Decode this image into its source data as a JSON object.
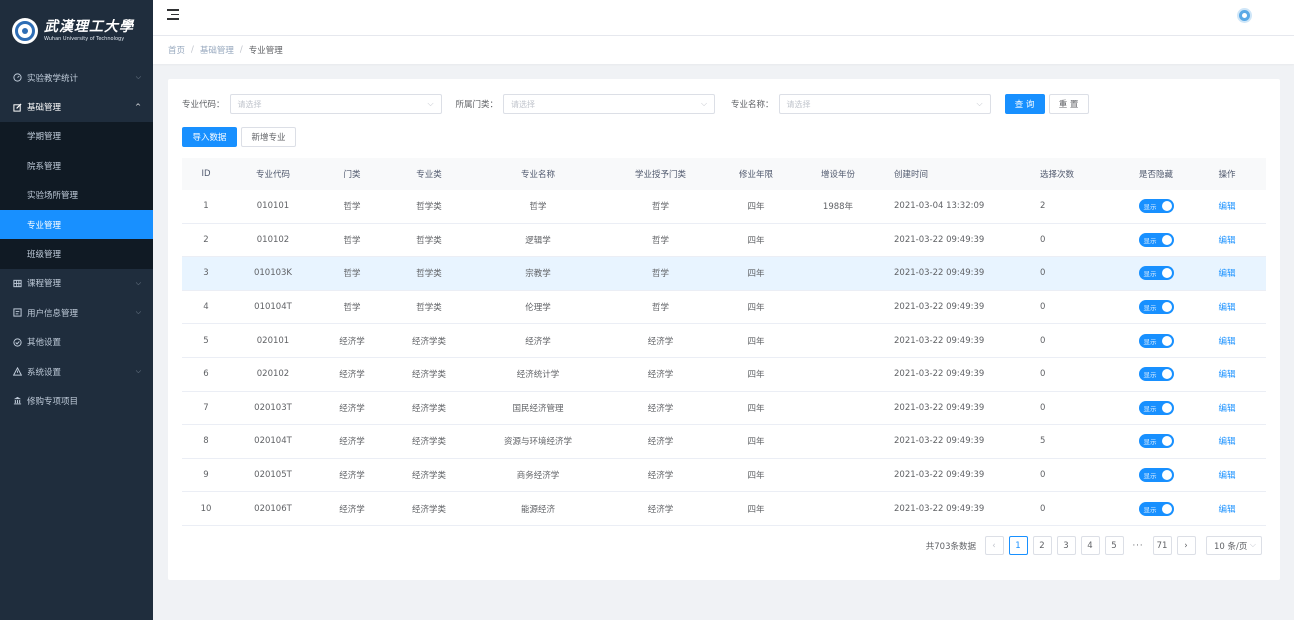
{
  "sidebar": {
    "logo_cn": "武漢理工大學",
    "logo_en": "Wuhan University of Technology",
    "menu": [
      {
        "label": "实验教学统计",
        "icon": "dashboard-icon",
        "chevron": "chevron-down-icon"
      },
      {
        "label": "基础管理",
        "icon": "edit-icon",
        "chevron": "chevron-up-icon"
      },
      {
        "label": "课程管理",
        "icon": "table-icon",
        "chevron": "chevron-down-icon"
      },
      {
        "label": "用户信息管理",
        "icon": "profile-icon",
        "chevron": "chevron-down-icon"
      },
      {
        "label": "其他设置",
        "icon": "check-circle-icon"
      },
      {
        "label": "系统设置",
        "icon": "warning-icon",
        "chevron": "chevron-down-icon"
      },
      {
        "label": "修购专项项目",
        "icon": "bank-icon"
      }
    ],
    "submenu": [
      {
        "label": "学期管理"
      },
      {
        "label": "院系管理"
      },
      {
        "label": "实验场所管理"
      },
      {
        "label": "专业管理"
      },
      {
        "label": "班级管理"
      }
    ],
    "active_submenu": "专业管理"
  },
  "breadcrumb": [
    "首页",
    "基础管理",
    "专业管理"
  ],
  "filters": {
    "code_label": "专业代码：",
    "code_placeholder": "请选择",
    "category_label": "所属门类：",
    "category_placeholder": "请选择",
    "name_label": "专业名称：",
    "name_placeholder": "请选择",
    "query_label": "查 询",
    "reset_label": "重 置"
  },
  "actions": {
    "import_label": "导入数据",
    "add_label": "新增专业"
  },
  "table": {
    "headers": [
      "ID",
      "专业代码",
      "门类",
      "专业类",
      "专业名称",
      "学业授予门类",
      "修业年限",
      "增设年份",
      "创建时间",
      "选择次数",
      "是否隐藏",
      "操作"
    ],
    "rows": [
      {
        "id": "1",
        "code": "010101",
        "category": "哲学",
        "cls": "哲学类",
        "name": "哲学",
        "degree": "哲学",
        "years": "四年",
        "year_added": "1988年",
        "created": "2021-03-04 13:32:09",
        "count": "2",
        "hidden": "显示",
        "op": "编辑"
      },
      {
        "id": "2",
        "code": "010102",
        "category": "哲学",
        "cls": "哲学类",
        "name": "逻辑学",
        "degree": "哲学",
        "years": "四年",
        "year_added": "",
        "created": "2021-03-22 09:49:39",
        "count": "0",
        "hidden": "显示",
        "op": "编辑"
      },
      {
        "id": "3",
        "code": "010103K",
        "category": "哲学",
        "cls": "哲学类",
        "name": "宗教学",
        "degree": "哲学",
        "years": "四年",
        "year_added": "",
        "created": "2021-03-22 09:49:39",
        "count": "0",
        "hidden": "显示",
        "op": "编辑"
      },
      {
        "id": "4",
        "code": "010104T",
        "category": "哲学",
        "cls": "哲学类",
        "name": "伦理学",
        "degree": "哲学",
        "years": "四年",
        "year_added": "",
        "created": "2021-03-22 09:49:39",
        "count": "0",
        "hidden": "显示",
        "op": "编辑"
      },
      {
        "id": "5",
        "code": "020101",
        "category": "经济学",
        "cls": "经济学类",
        "name": "经济学",
        "degree": "经济学",
        "years": "四年",
        "year_added": "",
        "created": "2021-03-22 09:49:39",
        "count": "0",
        "hidden": "显示",
        "op": "编辑"
      },
      {
        "id": "6",
        "code": "020102",
        "category": "经济学",
        "cls": "经济学类",
        "name": "经济统计学",
        "degree": "经济学",
        "years": "四年",
        "year_added": "",
        "created": "2021-03-22 09:49:39",
        "count": "0",
        "hidden": "显示",
        "op": "编辑"
      },
      {
        "id": "7",
        "code": "020103T",
        "category": "经济学",
        "cls": "经济学类",
        "name": "国民经济管理",
        "degree": "经济学",
        "years": "四年",
        "year_added": "",
        "created": "2021-03-22 09:49:39",
        "count": "0",
        "hidden": "显示",
        "op": "编辑"
      },
      {
        "id": "8",
        "code": "020104T",
        "category": "经济学",
        "cls": "经济学类",
        "name": "资源与环境经济学",
        "degree": "经济学",
        "years": "四年",
        "year_added": "",
        "created": "2021-03-22 09:49:39",
        "count": "5",
        "hidden": "显示",
        "op": "编辑"
      },
      {
        "id": "9",
        "code": "020105T",
        "category": "经济学",
        "cls": "经济学类",
        "name": "商务经济学",
        "degree": "经济学",
        "years": "四年",
        "year_added": "",
        "created": "2021-03-22 09:49:39",
        "count": "0",
        "hidden": "显示",
        "op": "编辑"
      },
      {
        "id": "10",
        "code": "020106T",
        "category": "经济学",
        "cls": "经济学类",
        "name": "能源经济",
        "degree": "经济学",
        "years": "四年",
        "year_added": "",
        "created": "2021-03-22 09:49:39",
        "count": "0",
        "hidden": "显示",
        "op": "编辑"
      }
    ],
    "highlighted_row": 3
  },
  "pagination": {
    "total": "共703条数据",
    "prev": "‹",
    "pages": [
      "1",
      "2",
      "3",
      "4",
      "5"
    ],
    "ellipsis": "···",
    "last": "71",
    "next": "›",
    "current": "1",
    "page_size": "10 条/页"
  },
  "colors": {
    "sidebar_bg": "#1f2d3d",
    "submenu_bg": "#101a24",
    "accent": "#1890ff",
    "highlight_row": "#e8f4ff"
  }
}
